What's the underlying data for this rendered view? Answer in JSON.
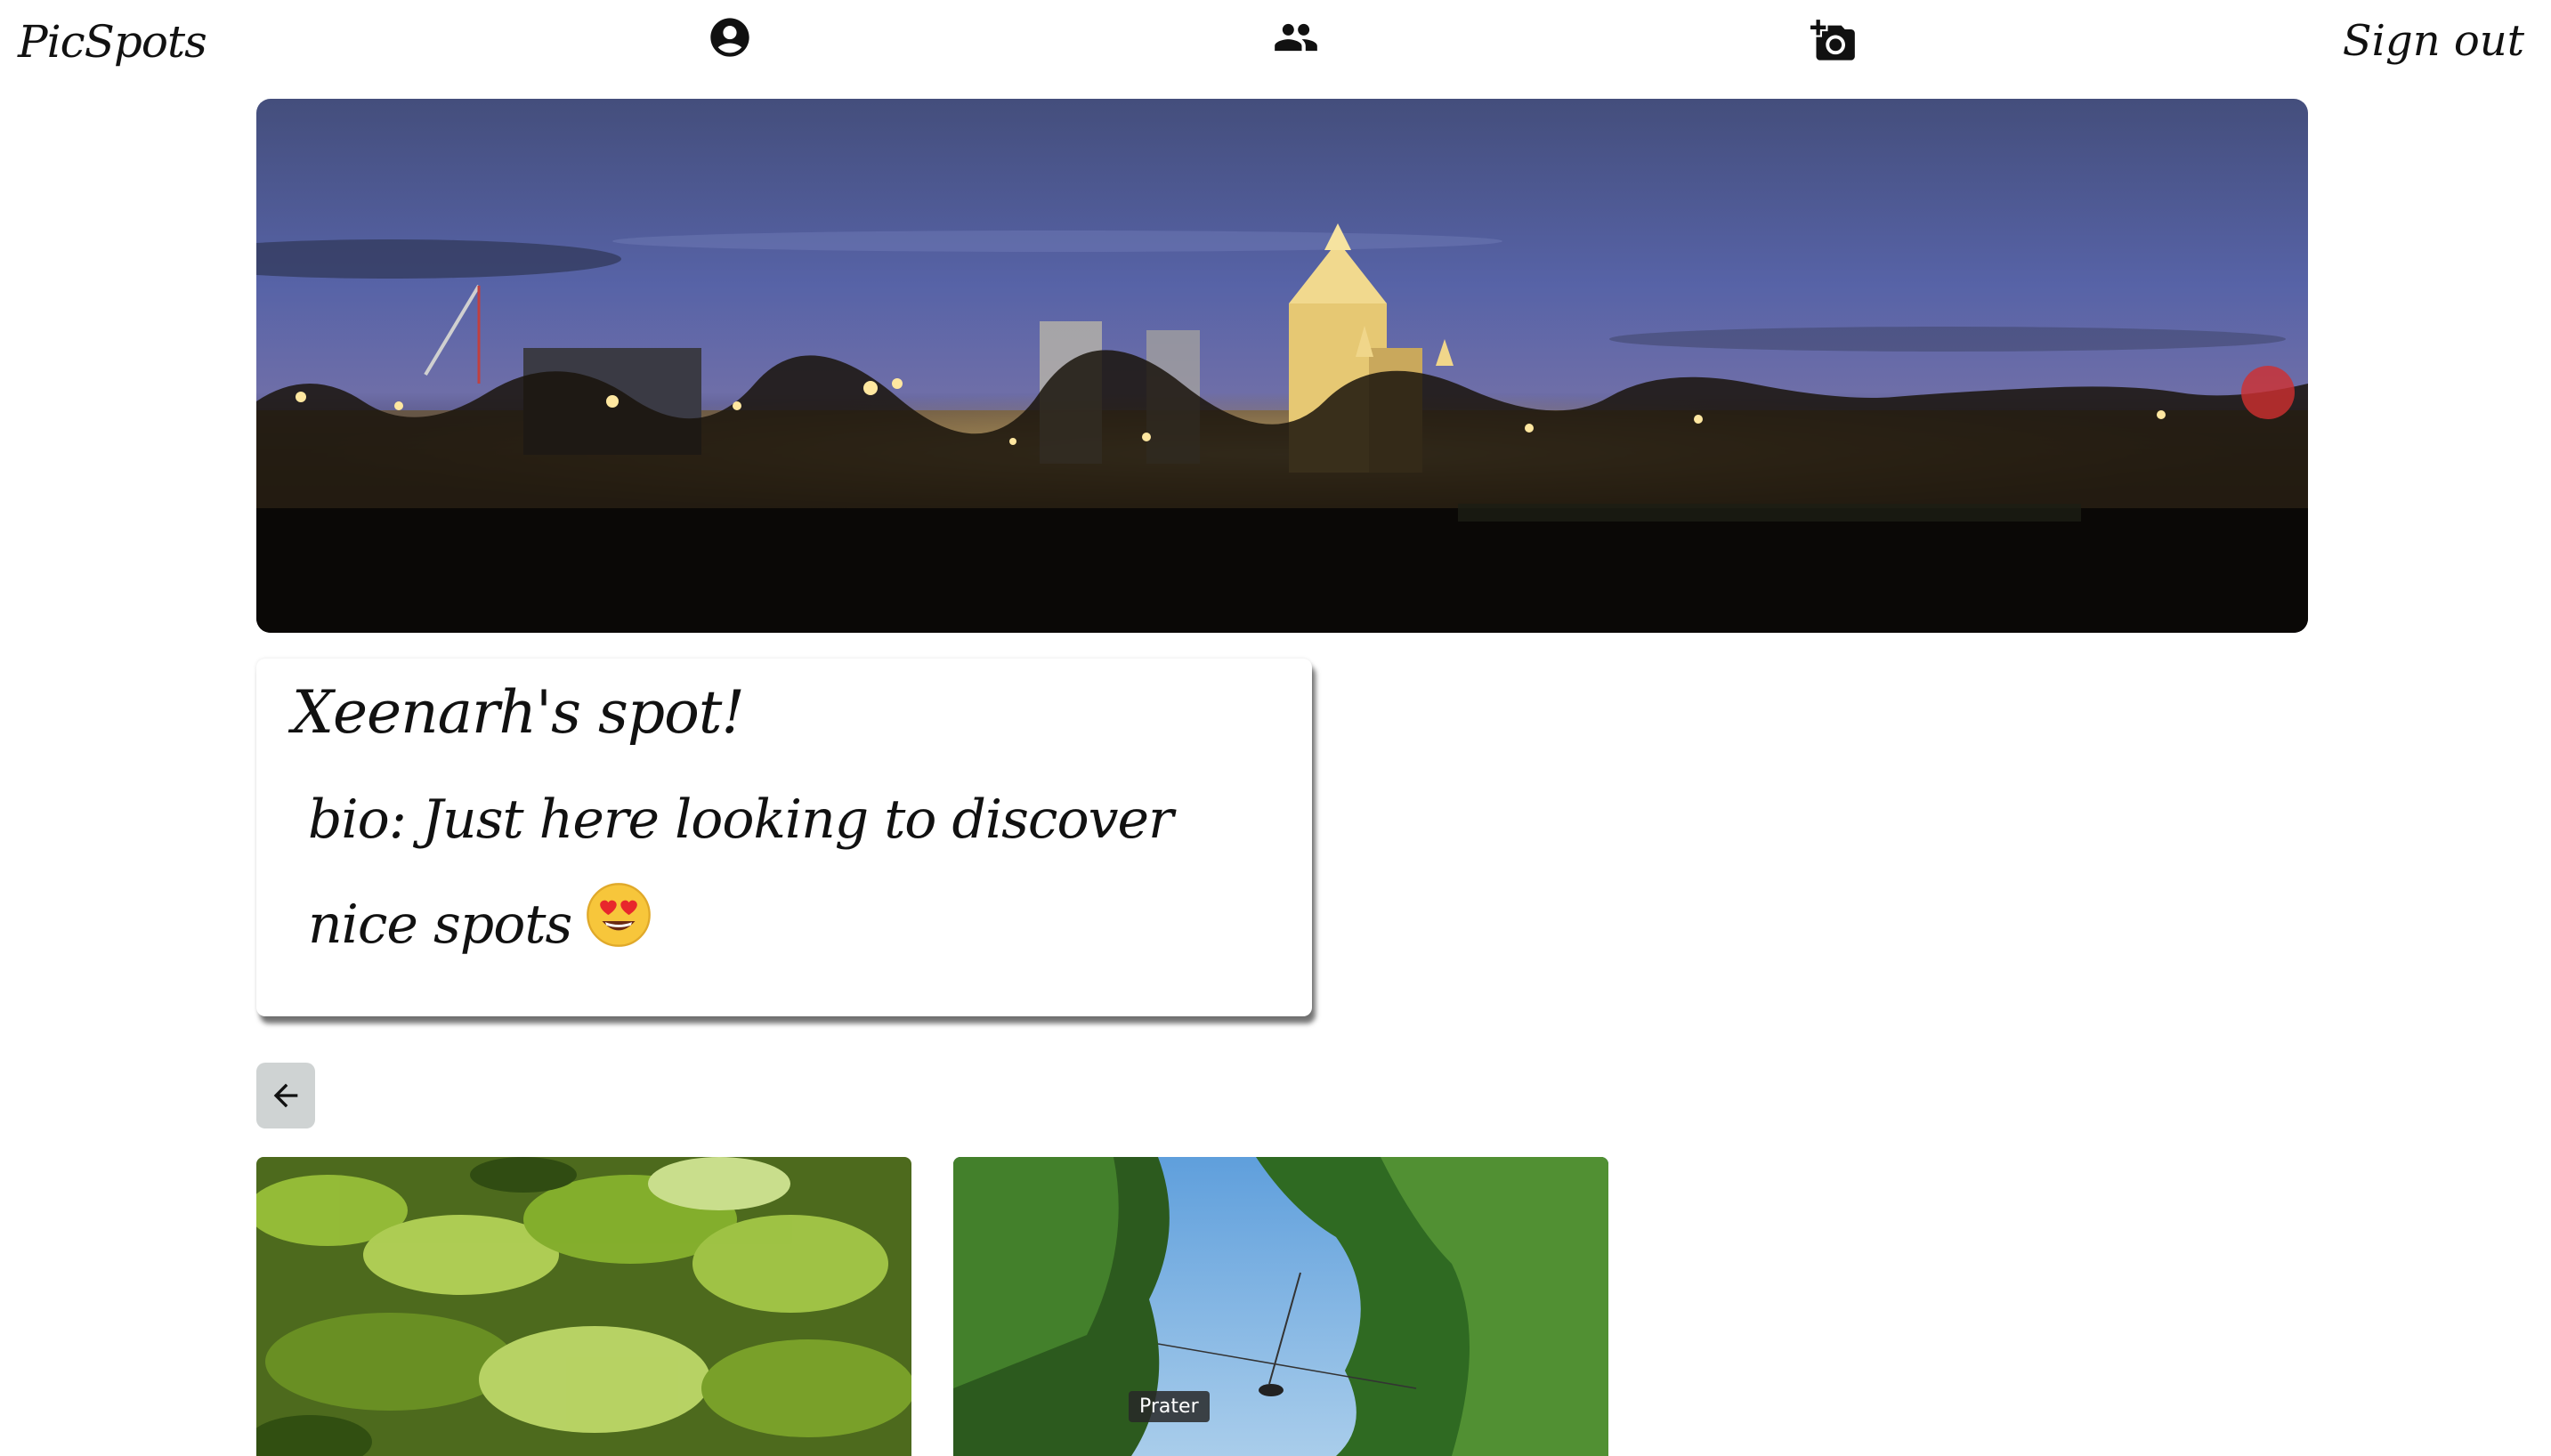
{
  "nav": {
    "brand": "PicSpots",
    "icons": [
      "account-circle-icon",
      "people-icon",
      "add-photo-icon"
    ],
    "sign_out": "Sign out"
  },
  "profile": {
    "title": "Xeenarh's spot!",
    "bio": "bio: Just here looking to discover nice spots",
    "bio_emoji": "smiling-face-with-heart-eyes"
  },
  "back_button": {
    "icon": "arrow-left-icon"
  },
  "photos": [
    {
      "description": "green-leaves",
      "tooltip": ""
    },
    {
      "description": "tree-lined-avenue",
      "tooltip": "Prater"
    }
  ]
}
